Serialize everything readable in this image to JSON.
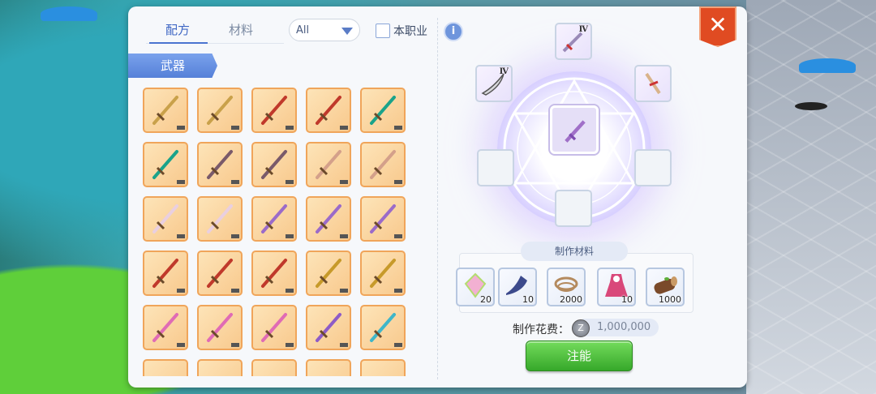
{
  "tabs": [
    {
      "label": "配方",
      "active": true
    },
    {
      "label": "材料",
      "active": false
    }
  ],
  "filter": {
    "selected": "All"
  },
  "own_class": {
    "label": "本职业",
    "checked": false
  },
  "info_icon": "info-icon",
  "category": {
    "label": "武器"
  },
  "recipe_grid": {
    "item_icons": [
      [
        "axe-icon",
        "axe-icon",
        "spear-icon",
        "spear-icon",
        "fin-blade-icon"
      ],
      [
        "fin-blade-icon",
        "greatsword-icon",
        "greatsword-icon",
        "hammer-icon",
        "hammer-icon"
      ],
      [
        "bone-club-icon",
        "bone-club-icon",
        "purple-sword-icon",
        "purple-sword-icon",
        "purple-sword-icon"
      ],
      [
        "red-blade-icon",
        "red-blade-icon",
        "red-blade-icon",
        "gold-rapier-icon",
        "gold-rapier-icon"
      ],
      [
        "pink-staff-icon",
        "pink-staff-icon",
        "pink-staff-icon",
        "purple-staff-icon",
        "crystal-staff-icon"
      ]
    ]
  },
  "crafting": {
    "top_slot": {
      "tier": "Ⅳ",
      "icon": "sword-icon"
    },
    "left_slot": {
      "tier": "Ⅳ",
      "icon": "scimitar-icon"
    },
    "right_slot": {
      "tier": "",
      "icon": "dagger-icon"
    },
    "center_slot": {
      "icon": "purple-sword-icon"
    }
  },
  "materials": {
    "title": "制作材料",
    "items": [
      {
        "icon": "gem-icon",
        "count": "20"
      },
      {
        "icon": "fish-tail-icon",
        "count": "10"
      },
      {
        "icon": "rope-icon",
        "count": "2000"
      },
      {
        "icon": "dress-icon",
        "count": "10"
      },
      {
        "icon": "log-icon",
        "count": "1000"
      }
    ]
  },
  "cost": {
    "label": "制作花费：",
    "value": "1,000,000",
    "coin_symbol": "Z"
  },
  "action_button": {
    "label": "注能"
  },
  "close_symbol": "✕"
}
